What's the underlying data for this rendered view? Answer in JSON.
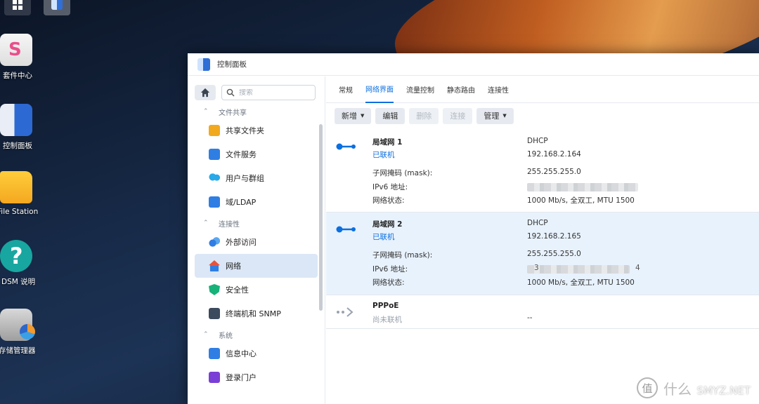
{
  "desktop": {
    "icons": [
      {
        "label": "套件中心"
      },
      {
        "label": "控制面板"
      },
      {
        "label": "File Station"
      },
      {
        "label": "DSM 说明"
      },
      {
        "label": "存储管理器"
      }
    ]
  },
  "window": {
    "title": "控制面板"
  },
  "sidebar": {
    "search_placeholder": "搜索",
    "sections": [
      {
        "label": "文件共享",
        "items": [
          "共享文件夹",
          "文件服务",
          "用户与群组",
          "域/LDAP"
        ]
      },
      {
        "label": "连接性",
        "items": [
          "外部访问",
          "网络",
          "安全性",
          "终端机和 SNMP"
        ]
      },
      {
        "label": "系统",
        "items": [
          "信息中心",
          "登录门户"
        ]
      }
    ],
    "active_item": "网络"
  },
  "tabs": [
    "常规",
    "网络界面",
    "流量控制",
    "静态路由",
    "连接性"
  ],
  "active_tab": "网络界面",
  "toolbar": {
    "add": "新增",
    "edit": "编辑",
    "delete": "删除",
    "connect": "连接",
    "manage": "管理"
  },
  "interfaces": [
    {
      "name": "局域网 1",
      "status": "已联机",
      "mode": "DHCP",
      "ip": "192.168.2.164",
      "mask_label": "子网掩码 (mask):",
      "mask": "255.255.255.0",
      "ipv6_label": "IPv6 地址:",
      "net_label": "网络状态:",
      "net": "1000 Mb/s, 全双工, MTU 1500"
    },
    {
      "name": "局域网 2",
      "status": "已联机",
      "mode": "DHCP",
      "ip": "192.168.2.165",
      "mask_label": "子网掩码 (mask):",
      "mask": "255.255.255.0",
      "ipv6_label": "IPv6 地址:",
      "ipv6_start": "3",
      "ipv6_end": "4",
      "net_label": "网络状态:",
      "net": "1000 Mb/s, 全双工, MTU 1500"
    },
    {
      "name": "PPPoE",
      "status": "尚未联机",
      "value": "--"
    }
  ],
  "watermark": {
    "logo": "值",
    "text": "什么",
    "site": "SMYZ.NET"
  },
  "colors": {
    "accent": "#0b6fe0",
    "selected_row": "#e8f2fd",
    "active_nav": "#dbe7f6"
  }
}
